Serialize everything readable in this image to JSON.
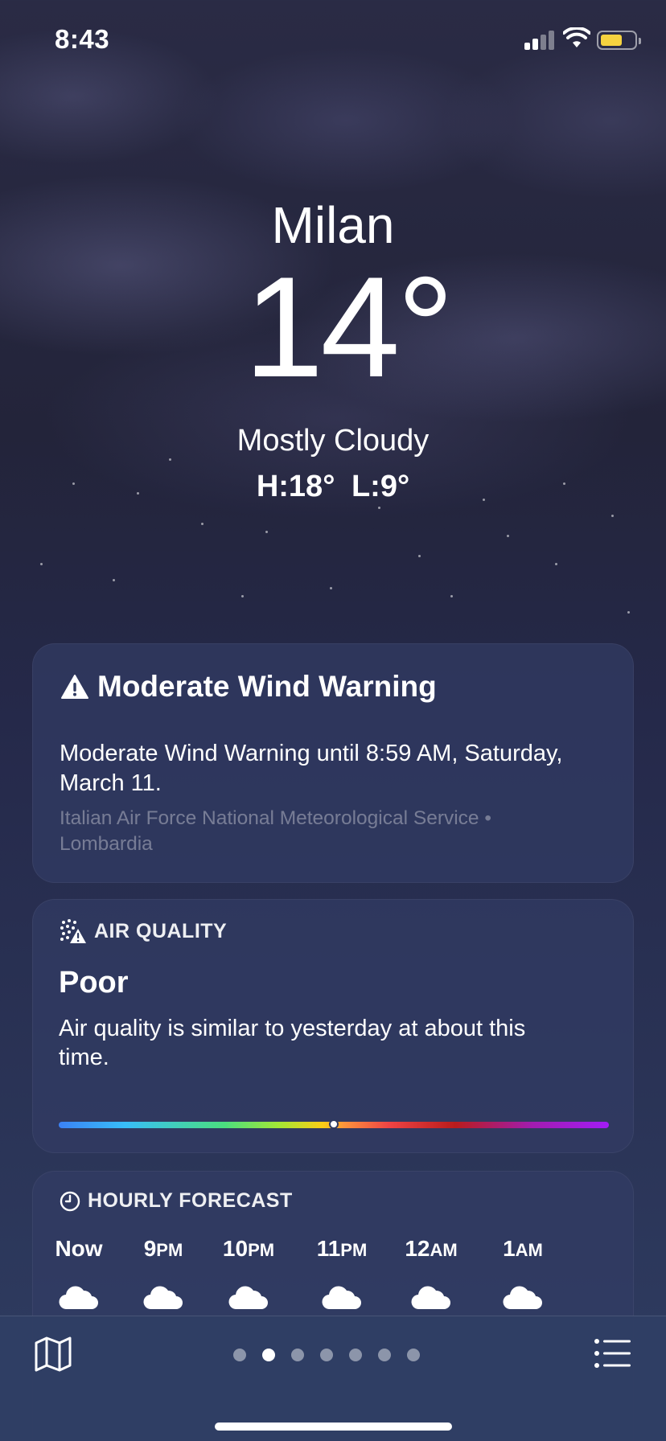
{
  "status_bar": {
    "time": "8:43",
    "battery_level": 0.65,
    "battery_color": "#f6d33f"
  },
  "location": {
    "city": "Milan",
    "temperature": "14°",
    "condition": "Mostly Cloudy",
    "high_low": "H:18°  L:9°"
  },
  "warning": {
    "icon": "warning-triangle-icon",
    "title": "Moderate Wind Warning",
    "body": "Moderate Wind Warning until 8:59 AM, Saturday, March 11.",
    "source": "Italian Air Force National Meteorological Service • Lombardia"
  },
  "air_quality": {
    "icon": "air-quality-icon",
    "header": "AIR QUALITY",
    "value": "Poor",
    "description": "Air quality is similar to yesterday at about this time.",
    "level": 0.5
  },
  "hourly": {
    "icon": "clock-icon",
    "header": "HOURLY FORECAST",
    "hours": [
      {
        "main": "Now",
        "suffix": "",
        "icon": "cloud-icon"
      },
      {
        "main": "9",
        "suffix": "PM",
        "icon": "cloud-icon"
      },
      {
        "main": "10",
        "suffix": "PM",
        "icon": "cloud-icon"
      },
      {
        "main": "11",
        "suffix": "PM",
        "icon": "cloud-icon"
      },
      {
        "main": "12",
        "suffix": "AM",
        "icon": "cloud-icon"
      },
      {
        "main": "1",
        "suffix": "AM",
        "icon": "cloud-icon"
      }
    ]
  },
  "toolbar": {
    "map_icon": "map-icon",
    "list_icon": "list-icon",
    "page_count": 7,
    "active_page": 1
  }
}
